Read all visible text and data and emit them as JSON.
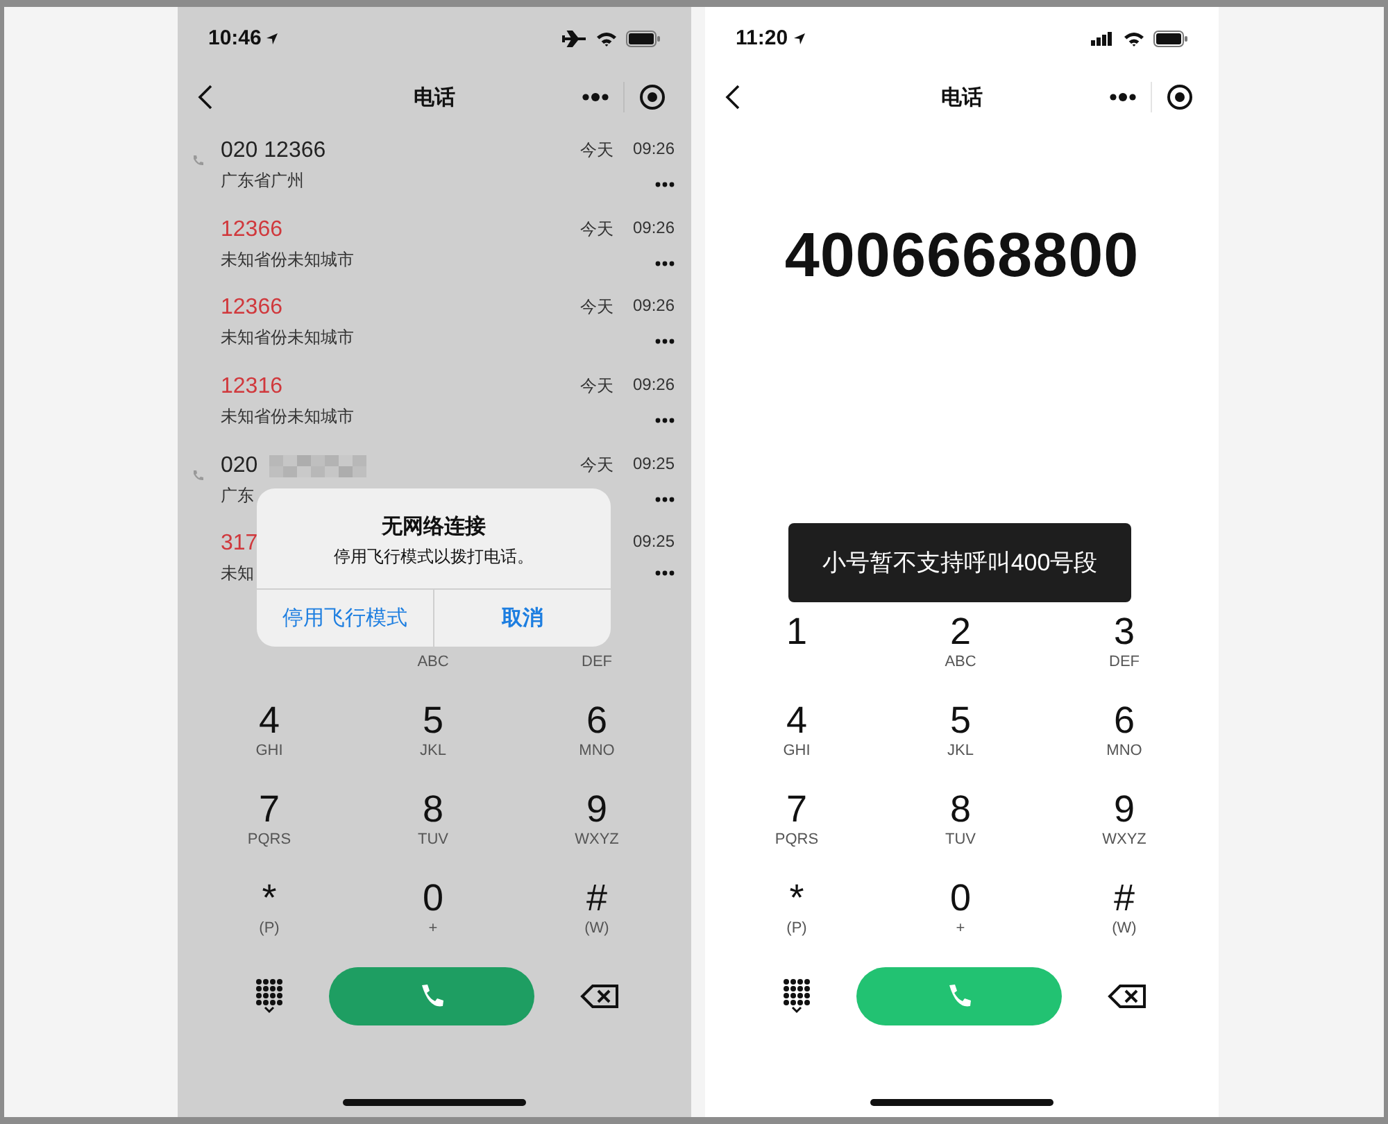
{
  "phones": [
    {
      "dimmed": true,
      "status_bar": {
        "time": "10:46",
        "airplane_mode": true
      },
      "nav": {
        "title": "电话"
      },
      "call_log": [
        {
          "number": "020 12366",
          "location": "广东省广州",
          "date": "今天",
          "time": "09:26",
          "missed": false
        },
        {
          "number": "12366",
          "location": "未知省份未知城市",
          "date": "今天",
          "time": "09:26",
          "missed": true
        },
        {
          "number": "12366",
          "location": "未知省份未知城市",
          "date": "今天",
          "time": "09:26",
          "missed": true
        },
        {
          "number": "12316",
          "location": "未知省份未知城市",
          "date": "今天",
          "time": "09:26",
          "missed": true
        },
        {
          "number": "020",
          "redacted": true,
          "location": "广东",
          "date": "今天",
          "time": "09:25",
          "missed": false
        },
        {
          "number": "317",
          "location": "未知",
          "time": "09:25",
          "missed": true
        }
      ],
      "keypad": [
        {
          "letters": "ABC"
        },
        {
          "letters": "DEF"
        },
        {
          "digit": "4",
          "letters": "GHI"
        },
        {
          "digit": "5",
          "letters": "JKL"
        },
        {
          "digit": "6",
          "letters": "MNO"
        },
        {
          "digit": "7",
          "letters": "PQRS"
        },
        {
          "digit": "8",
          "letters": "TUV"
        },
        {
          "digit": "9",
          "letters": "WXYZ"
        },
        {
          "digit": "*",
          "letters": "(P)"
        },
        {
          "digit": "0",
          "letters": "+"
        },
        {
          "digit": "#",
          "letters": "(W)"
        }
      ],
      "alert": {
        "title": "无网络连接",
        "message": "停用飞行模式以拨打电话。",
        "buttons": [
          "停用飞行模式",
          "取消"
        ]
      }
    },
    {
      "dimmed": false,
      "status_bar": {
        "time": "11:20",
        "airplane_mode": false
      },
      "nav": {
        "title": "电话"
      },
      "dialed_number": "4006668800",
      "keypad": [
        {
          "digit": "1"
        },
        {
          "digit": "2",
          "letters": "ABC"
        },
        {
          "digit": "3",
          "letters": "DEF"
        },
        {
          "digit": "4",
          "letters": "GHI"
        },
        {
          "digit": "5",
          "letters": "JKL"
        },
        {
          "digit": "6",
          "letters": "MNO"
        },
        {
          "digit": "7",
          "letters": "PQRS"
        },
        {
          "digit": "8",
          "letters": "TUV"
        },
        {
          "digit": "9",
          "letters": "WXYZ"
        },
        {
          "digit": "*",
          "letters": "(P)"
        },
        {
          "digit": "0",
          "letters": "+"
        },
        {
          "digit": "#",
          "letters": "(W)"
        }
      ],
      "toast": "小号暂不支持呼叫400号段"
    }
  ]
}
